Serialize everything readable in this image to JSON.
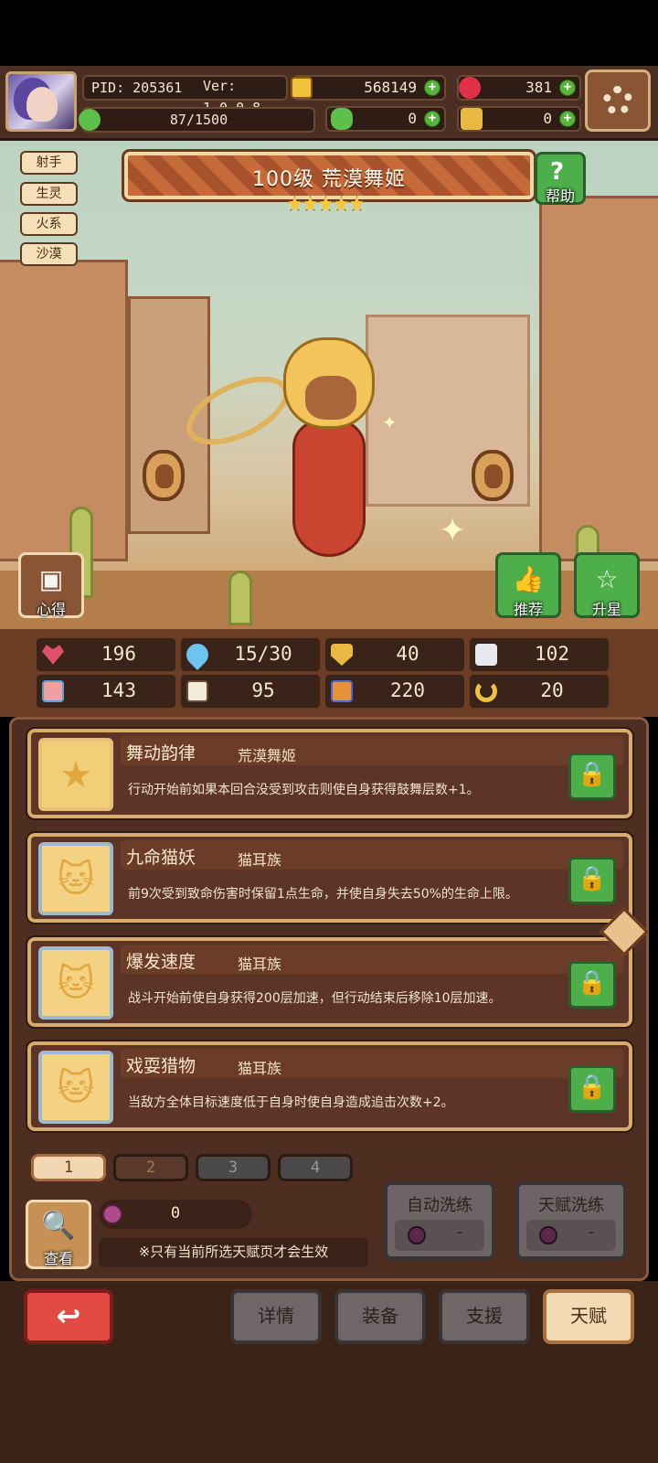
{
  "header": {
    "pid": "PID: 205361",
    "version": "Ver: 1.0.0.8",
    "energy": "87/1500",
    "gold": "568149",
    "gems": "381",
    "clover": "0",
    "item": "0"
  },
  "tags": [
    "射手",
    "生灵",
    "火系",
    "沙漠"
  ],
  "hero": {
    "title": "100级  荒漠舞姬",
    "stars": 5,
    "help_label": "帮助",
    "xinde_label": "心得",
    "recommend_label": "推荐",
    "upgrade_label": "升星"
  },
  "stats": [
    {
      "icon": "heart-icon",
      "value": "196"
    },
    {
      "icon": "mana-drop-icon",
      "value": "15/30"
    },
    {
      "icon": "shield-icon",
      "value": "40"
    },
    {
      "icon": "wing-icon",
      "value": "102"
    },
    {
      "icon": "fist-icon",
      "value": "143"
    },
    {
      "icon": "book-icon",
      "value": "95"
    },
    {
      "icon": "boot-icon",
      "value": "220"
    },
    {
      "icon": "horseshoe-icon",
      "value": "20"
    }
  ],
  "talents": [
    {
      "name": "舞动韵律",
      "race": "荒漠舞姬",
      "desc": "行动开始前如果本回合没受到攻击则使自身获得鼓舞层数+1。"
    },
    {
      "name": "九命猫妖",
      "race": "猫耳族",
      "desc": "前9次受到致命伤害时保留1点生命，并使自身失去50%的生命上限。"
    },
    {
      "name": "爆发速度",
      "race": "猫耳族",
      "desc": "战斗开始前使自身获得200层加速，但行动结束后移除10层加速。"
    },
    {
      "name": "戏耍猎物",
      "race": "猫耳族",
      "desc": "当敌方全体目标速度低于自身时使自身造成追击次数+2。"
    }
  ],
  "tabs": [
    "1",
    "2",
    "3",
    "4"
  ],
  "panel_bottom": {
    "look_label": "查看",
    "fruit_count": "0",
    "note": "※只有当前所选天赋页才会生效",
    "auto_wash_label": "自动洗练",
    "auto_wash_value": "-",
    "talent_wash_label": "天赋洗练",
    "talent_wash_value": "-"
  },
  "nav": {
    "details": "详情",
    "equipment": "装备",
    "support": "支援",
    "talent": "天赋"
  },
  "colors": {
    "accent_green": "#4caf4a",
    "gold_border": "#d8ac6c",
    "back_red": "#e24a43"
  }
}
